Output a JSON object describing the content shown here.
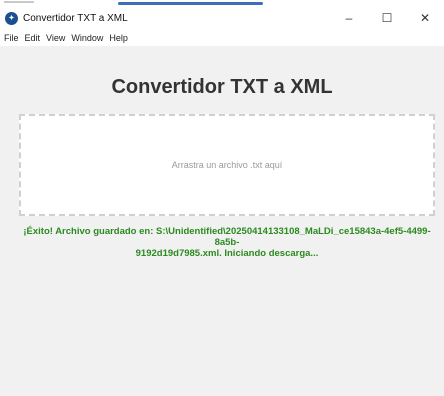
{
  "window": {
    "title": "Convertidor TXT a XML",
    "controls": {
      "minimize": "–",
      "maximize": "☐",
      "close": "✕"
    }
  },
  "menu": {
    "items": [
      {
        "label": "File"
      },
      {
        "label": "Edit"
      },
      {
        "label": "View"
      },
      {
        "label": "Window"
      },
      {
        "label": "Help"
      }
    ]
  },
  "main": {
    "title": "Convertidor TXT a XML",
    "dropzone_text": "Arrastra un archivo .txt aquí",
    "success_line1": "¡Éxito! Archivo guardado en: S:\\Unidentified\\20250414133108_MaLDi_ce15843a-4ef5-4499-8a5b-",
    "success_line2": "9192d19d7985.xml. Iniciando descarga..."
  },
  "colors": {
    "success": "#2b8a1f",
    "background": "#f1f1f1",
    "app_icon": "#1b4f8f"
  },
  "icons": {
    "app": "app-icon"
  }
}
